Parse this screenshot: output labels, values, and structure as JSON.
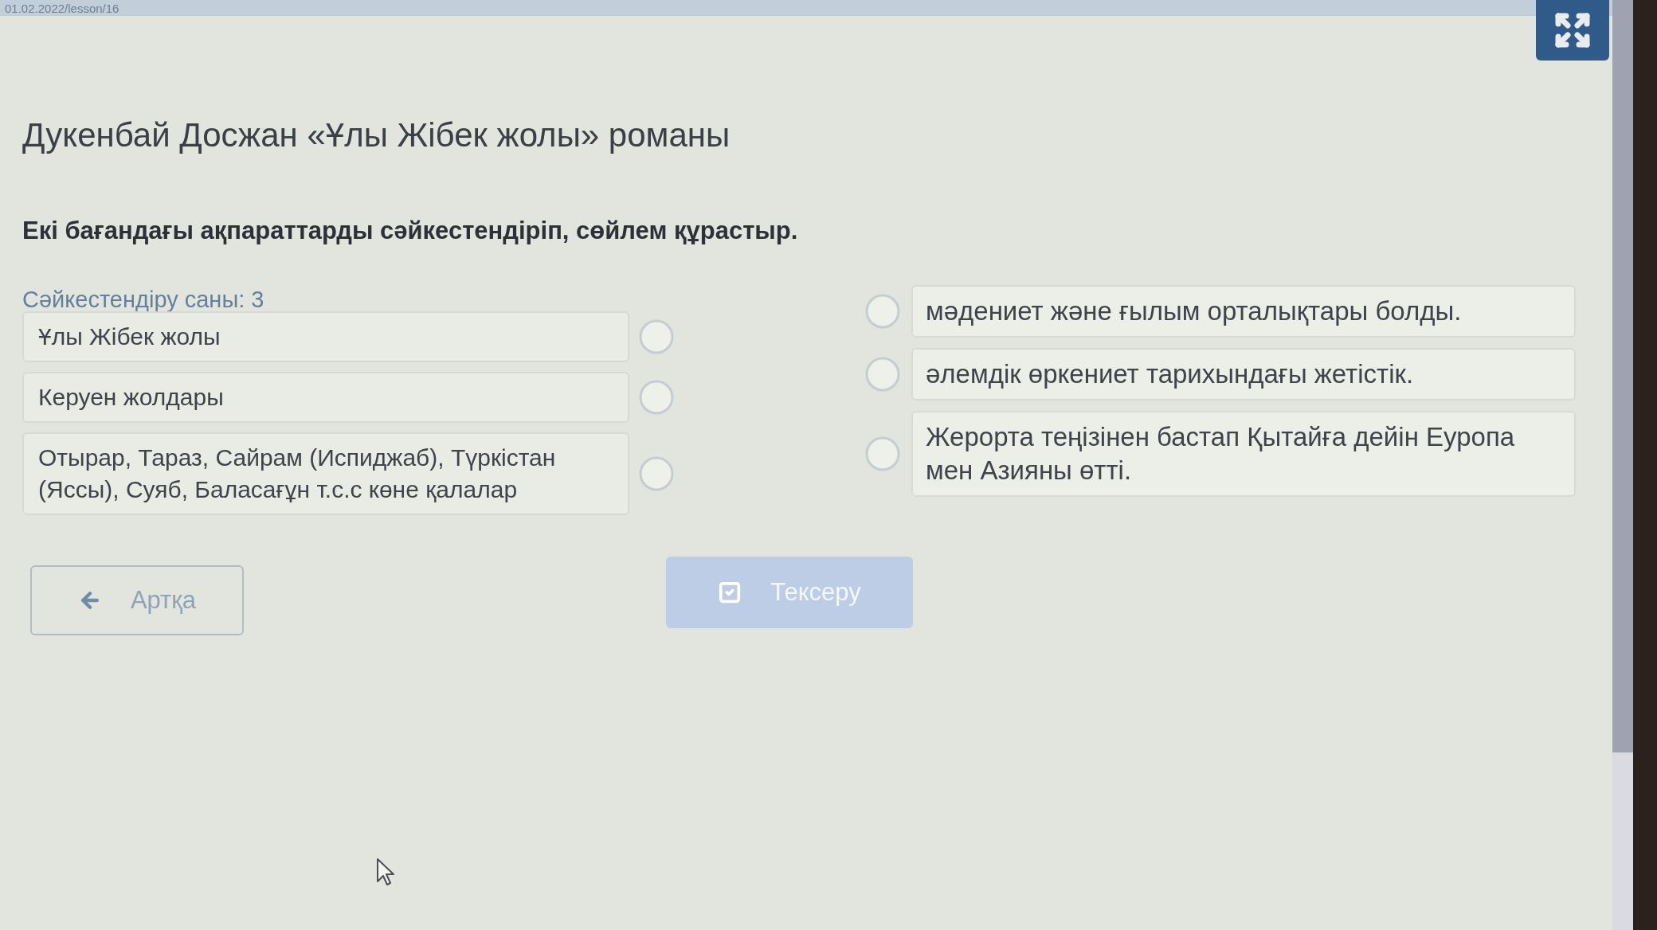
{
  "address_bar": {
    "url_fragment": "01.02.2022/lesson/16"
  },
  "title": "Дукенбай Досжан «Ұлы Жібек жолы» романы",
  "instruction": "Екі бағандағы ақпараттарды сәйкестендіріп, сөйлем құрастыр.",
  "match_count": "Сәйкестендіру саны: 3",
  "left_items": [
    {
      "text": "Ұлы Жібек жолы"
    },
    {
      "text": "Керуен жолдары"
    },
    {
      "text": "Отырар, Тараз, Сайрам (Испиджаб), Түркістан (Яссы), Суяб, Баласағұн т.с.с көне қалалар"
    }
  ],
  "right_items": [
    {
      "text": "мәдениет және ғылым орталықтары болды."
    },
    {
      "text": "әлемдік өркениет тарихындағы жетістік."
    },
    {
      "text": "Жерорта теңізінен бастап Қытайға дейін Еуропа мен Азияны өтті."
    }
  ],
  "buttons": [
    {
      "kind": "back",
      "label": "Артқа",
      "disabled": false
    },
    {
      "kind": "check",
      "label": "Тексеру",
      "disabled": true
    }
  ]
}
